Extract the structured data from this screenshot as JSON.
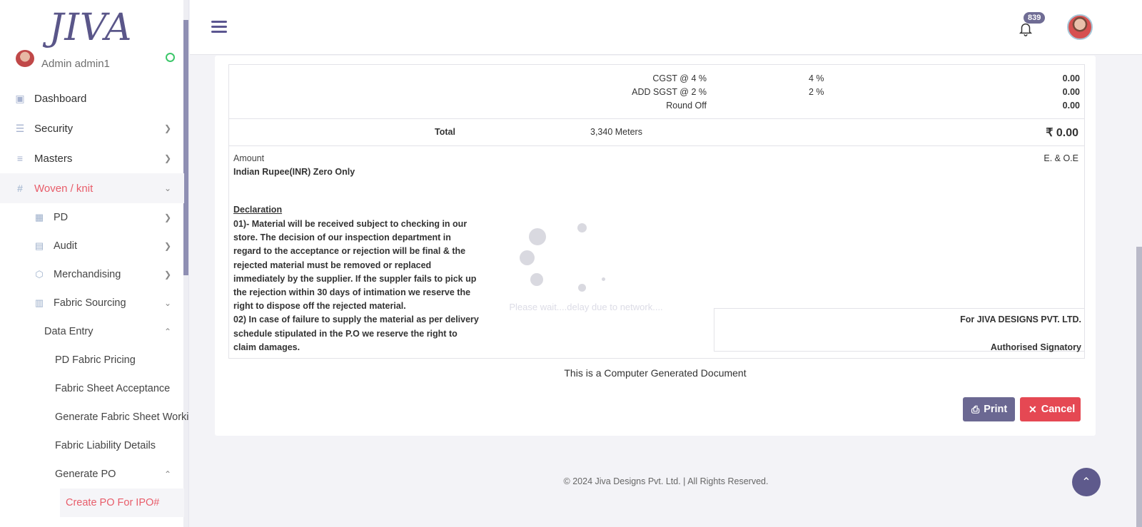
{
  "brand": {
    "logo_text": "JIVA"
  },
  "user": {
    "name": "Admin admin1"
  },
  "sidebar": {
    "items": [
      {
        "label": "Dashboard",
        "icon": "grid-icon"
      },
      {
        "label": "Security",
        "icon": "sliders-icon"
      },
      {
        "label": "Masters",
        "icon": "speed-icon"
      },
      {
        "label": "Woven / knit",
        "icon": "hash-icon"
      }
    ],
    "sub_items": [
      {
        "label": "PD",
        "icon": "table-icon"
      },
      {
        "label": "Audit",
        "icon": "list-icon"
      },
      {
        "label": "Merchandising",
        "icon": "box-icon"
      },
      {
        "label": "Fabric Sourcing",
        "icon": "document-icon"
      }
    ],
    "data_entry": "Data Entry",
    "data_entry_items": [
      "PD Fabric Pricing",
      "Fabric Sheet Acceptance",
      "Generate Fabric Sheet Working",
      "Fabric Liability Details"
    ],
    "generate_po": "Generate PO",
    "create_po": "Create PO For IPO#"
  },
  "header": {
    "notification_count": "839"
  },
  "document": {
    "taxes": [
      {
        "label": "CGST @ 4 %",
        "rate": "4 %",
        "amount": "0.00"
      },
      {
        "label": "ADD SGST @ 2 %",
        "rate": "2 %",
        "amount": "0.00"
      },
      {
        "label": "Round Off",
        "rate": "",
        "amount": "0.00"
      }
    ],
    "total": {
      "label": "Total",
      "quantity": "3,340 Meters",
      "amount": "₹ 0.00"
    },
    "amount_label": "Amount",
    "amount_words": "Indian Rupee(INR) Zero Only",
    "eoe": "E. & O.E",
    "declaration_title": "Declaration",
    "declaration_text": "01)- Material will be received subject to checking in our store. The decision of our inspection department in regard to the acceptance or rejection will be final & the rejected material must be removed or replaced immediately by the supplier. If the suppler fails to pick up the rejection within 30 days of intimation we reserve the right to dispose off the rejected material.\n02) In case of failure to supply the material as per delivery schedule stipulated in the P.O we reserve the right to claim damages.",
    "for_company": "For JIVA DESIGNS PVT. LTD.",
    "signatory": "Authorised Signatory",
    "computer_generated": "This is a Computer Generated Document"
  },
  "actions": {
    "print_label": "Print",
    "cancel_label": "Cancel"
  },
  "loader": {
    "text": "Please wait....delay due to network...."
  },
  "footer": {
    "copyright": "© 2024 Jiva Designs Pvt. Ltd. | All Rights Reserved."
  }
}
